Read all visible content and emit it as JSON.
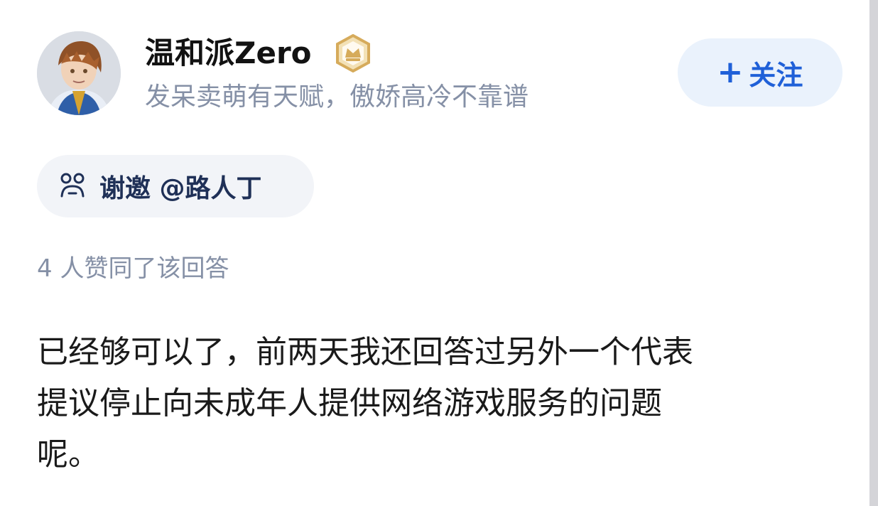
{
  "author": {
    "name": "温和派Zero",
    "bio": "发呆卖萌有天赋，傲娇高冷不靠谱",
    "badge_icon": "crown-badge-icon"
  },
  "follow": {
    "label": "关注",
    "plus": "+"
  },
  "invite": {
    "label": "谢邀 @路人丁"
  },
  "votes": {
    "text": "4 人赞同了该回答"
  },
  "answer": {
    "lines": [
      "已经够可以了，前两天我还回答过另外一个代表",
      "提议停止向未成年人提供网络游戏服务的问题",
      "呢。"
    ]
  },
  "colors": {
    "accent": "#1f60d8",
    "follow_bg": "#eaf2fc",
    "muted": "#8590a6",
    "invite_bg": "#f2f4f8",
    "invite_text": "#1f3057",
    "badge_gold": "#d6ab5b"
  }
}
